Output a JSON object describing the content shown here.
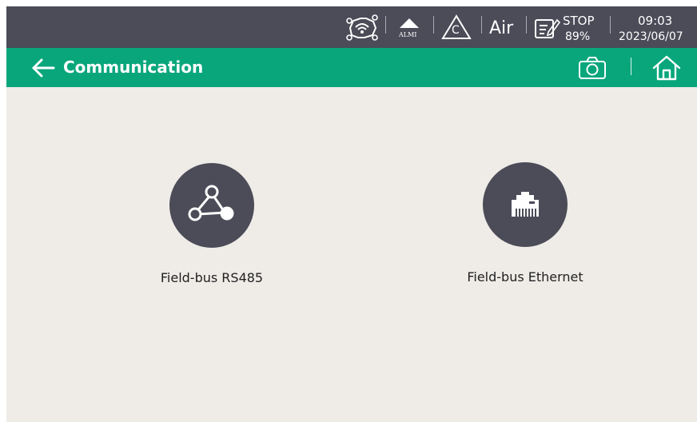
{
  "status_bar": {
    "icons": [
      "network-gear-icon",
      "alarm-triangle-icon",
      "calibration-triangle-icon",
      "notes-icon"
    ],
    "alarm_label": "ALMI",
    "calibration_label": "C",
    "medium_label": "Air",
    "run_state": "STOP",
    "run_percent": "89%",
    "time": "09:03",
    "date": "2023/06/07"
  },
  "header": {
    "title": "Communication",
    "back_icon": "arrow-left-icon",
    "camera_icon": "camera-icon",
    "home_icon": "home-icon"
  },
  "options": [
    {
      "label": "Field-bus RS485",
      "icon": "bus-topology-icon"
    },
    {
      "label": "Field-bus Ethernet",
      "icon": "ethernet-port-icon"
    }
  ],
  "colors": {
    "status_bar_bg": "#4b4c58",
    "header_bg": "#09a67c",
    "content_bg": "#efece8",
    "icon_circle": "#4b4c58"
  }
}
